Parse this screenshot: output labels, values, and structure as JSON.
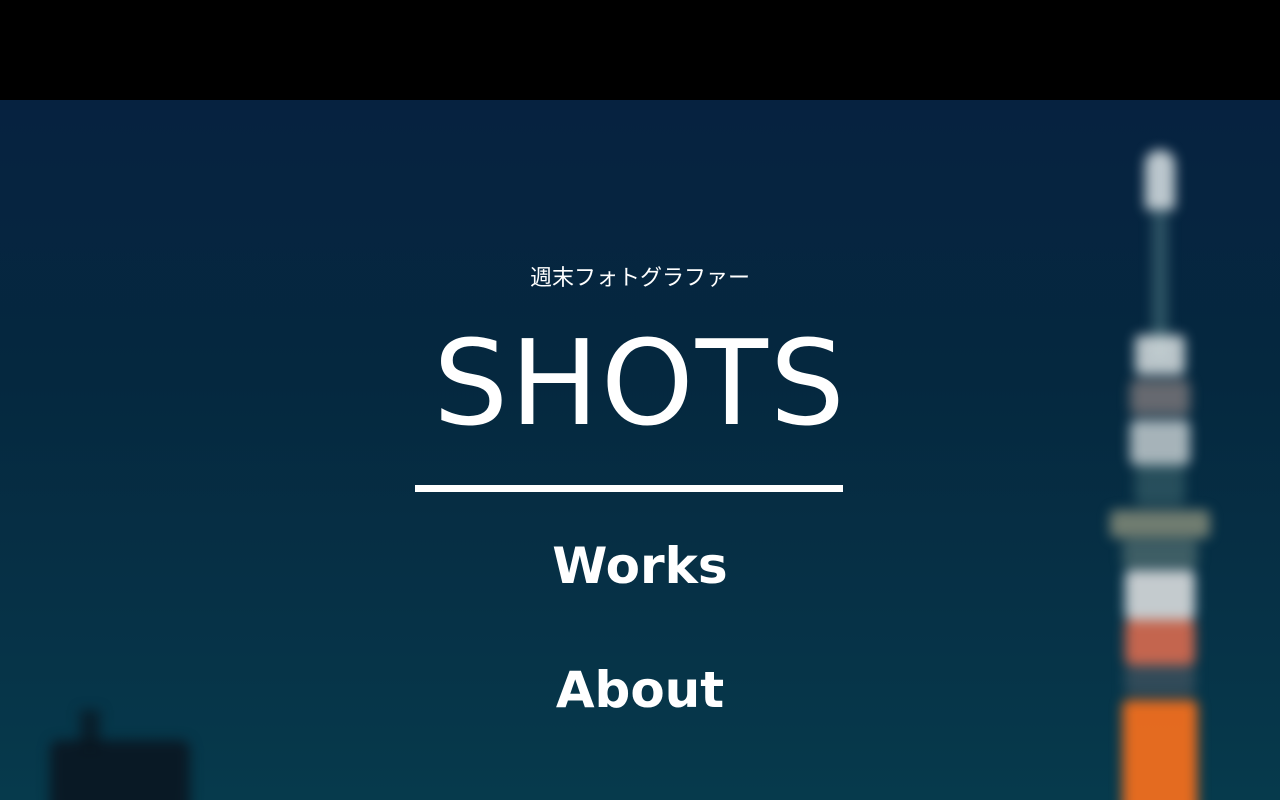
{
  "header": {
    "subtitle": "週末フォトグラファー",
    "title": "SHOTS"
  },
  "nav": {
    "items": [
      {
        "label": "Works"
      },
      {
        "label": "About"
      }
    ]
  },
  "colors": {
    "text": "#ffffff",
    "background_top": "#062240",
    "background_bottom": "#063a4c",
    "tower_accent": "#f07020"
  }
}
